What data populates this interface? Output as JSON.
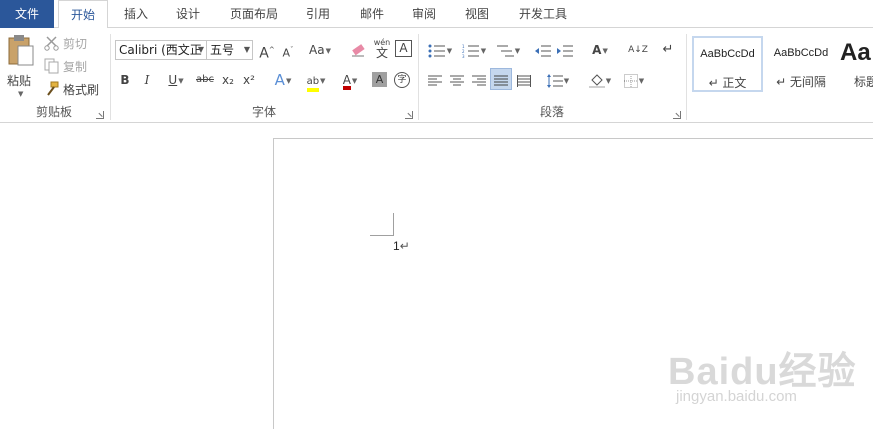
{
  "tabs": {
    "file": "文件",
    "home": "开始",
    "insert": "插入",
    "design": "设计",
    "layout": "页面布局",
    "references": "引用",
    "mailings": "邮件",
    "review": "审阅",
    "view": "视图",
    "developer": "开发工具"
  },
  "clipboard": {
    "paste": "粘贴",
    "cut": "剪切",
    "copy": "复制",
    "format_painter": "格式刷",
    "label": "剪贴板"
  },
  "font": {
    "font_name": "Calibri (西文正",
    "font_size": "五号",
    "grow": "A",
    "shrink": "A",
    "change_case": "Aa",
    "phonetic_top": "wén",
    "phonetic_bottom": "文",
    "char_border": "A",
    "bold": "B",
    "italic": "I",
    "underline": "U",
    "strikethrough": "abc",
    "subscript": "x₂",
    "superscript": "x²",
    "text_effects": "A",
    "highlight": "ab",
    "font_color": "A",
    "char_shading": "A",
    "enclose": "字",
    "label": "字体"
  },
  "paragraph": {
    "label": "段落",
    "chinese_layout": "A",
    "sort": "A↓Z",
    "show_marks": "↵"
  },
  "styles": {
    "items": [
      {
        "sample": "AaBbCcDd",
        "name": "↵ 正文"
      },
      {
        "sample": "AaBbCcDd",
        "name": "↵ 无间隔"
      },
      {
        "sample": "Aa",
        "name": "标题"
      }
    ]
  },
  "document": {
    "line_number": "1",
    "paragraph_mark": "↵"
  },
  "watermark": {
    "logo": "Baidu经验",
    "url": "jingyan.baidu.com"
  },
  "colors": {
    "file_tab": "#2b579a",
    "highlight_yellow": "#ffff00",
    "font_color_red": "#c00000",
    "selected_style_border": "#c5d7ee"
  }
}
